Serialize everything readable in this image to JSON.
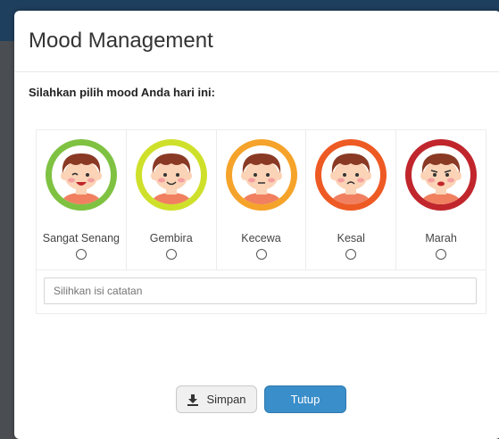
{
  "modal": {
    "title": "Mood Management",
    "prompt": "Silahkan pilih mood Anda hari ini:"
  },
  "moods": [
    {
      "label": "Sangat Senang",
      "ring": "#7fc242",
      "icon": "very-happy-face-icon"
    },
    {
      "label": "Gembira",
      "ring": "#cfe02a",
      "icon": "happy-face-icon"
    },
    {
      "label": "Kecewa",
      "ring": "#f5a32a",
      "icon": "disappointed-face-icon"
    },
    {
      "label": "Kesal",
      "ring": "#ee5a24",
      "icon": "annoyed-face-icon"
    },
    {
      "label": "Marah",
      "ring": "#c0262c",
      "icon": "angry-face-icon"
    }
  ],
  "notes": {
    "placeholder": "Silihkan isi catatan",
    "value": ""
  },
  "buttons": {
    "save_label": "Simpan",
    "close_label": "Tutup"
  },
  "colors": {
    "primary": "#3a8ec9",
    "skin": "#fbd3b6",
    "hair": "#8a3a24",
    "shirt": "#f08060"
  }
}
